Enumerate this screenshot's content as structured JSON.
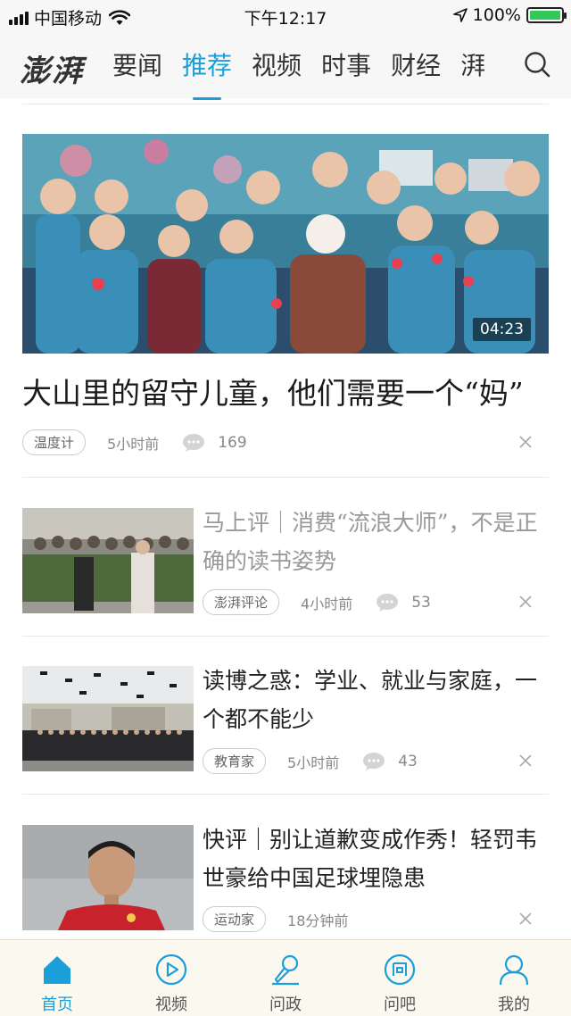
{
  "status_bar": {
    "carrier": "中国移动",
    "time": "下午12:17",
    "battery_percent": "100%",
    "battery_level": 1.0
  },
  "nav": {
    "logo": "澎湃",
    "tabs": [
      "要闻",
      "推荐",
      "视频",
      "时事",
      "财经",
      "湃"
    ],
    "active_tab": 1
  },
  "hero": {
    "duration": "04:23",
    "title": "大山里的留守儿童，他们需要一个“妈”",
    "tag": "温度计",
    "time": "5小时前",
    "comments": "169"
  },
  "articles": [
    {
      "title": "马上评｜消费“流浪大师”，不是正确的读书姿势",
      "tag": "澎湃评论",
      "time": "4小时前",
      "comments": "53",
      "read": true
    },
    {
      "title": "读博之惑：学业、就业与家庭，一个都不能少",
      "tag": "教育家",
      "time": "5小时前",
      "comments": "43",
      "read": false
    },
    {
      "title": "快评｜别让道歉变成作秀！轻罚韦世豪给中国足球埋隐患",
      "tag": "运动家",
      "time": "18分钟前",
      "comments": "",
      "read": false
    }
  ],
  "bottom_bar": {
    "items": [
      "首页",
      "视频",
      "问政",
      "问吧",
      "我的"
    ],
    "active": 0
  },
  "colors": {
    "accent": "#1a9fd8",
    "read_text": "#999999"
  }
}
